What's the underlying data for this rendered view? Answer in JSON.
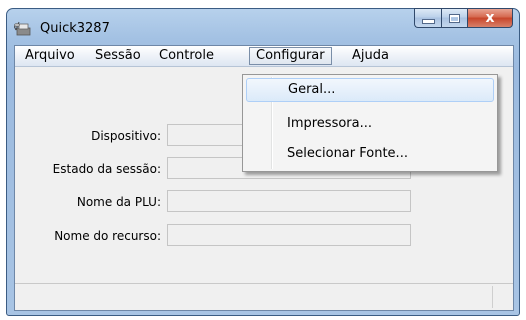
{
  "window": {
    "title": "Quick3287",
    "icon": "printer-satellite-icon",
    "caption_buttons": {
      "close_glyph": "x"
    }
  },
  "menubar": {
    "items": [
      {
        "label": "Arquivo"
      },
      {
        "label": "Sessão"
      },
      {
        "label": "Controle"
      },
      {
        "label": "Configurar",
        "open": true
      },
      {
        "label": "Ajuda"
      }
    ]
  },
  "form": {
    "fields": [
      {
        "label": "Dispositivo:",
        "value": ""
      },
      {
        "label": "Estado da sessão:",
        "value": ""
      },
      {
        "label": "Nome da PLU:",
        "value": ""
      },
      {
        "label": "Nome do recurso:",
        "value": ""
      }
    ]
  },
  "dropdown": {
    "items": [
      {
        "label": "Geral...",
        "highlighted": true
      },
      {
        "label": "Impressora..."
      },
      {
        "label": "Selecionar Fonte..."
      }
    ]
  },
  "colors": {
    "titlebar": "#a3c1e3",
    "close_button": "#c7452a",
    "highlight": "#dbeaf9"
  }
}
